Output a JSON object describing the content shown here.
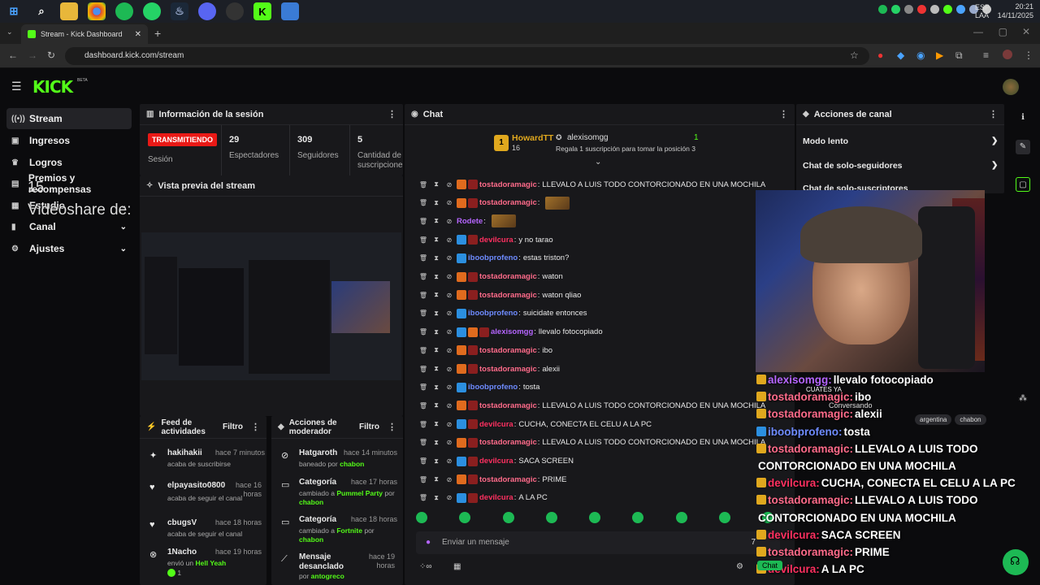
{
  "os": {
    "lang": "ESP\nLAA",
    "time": "20:21",
    "date": "14/11/2025"
  },
  "browser": {
    "tab_title": "Stream - Kick Dashboard",
    "url": "dashboard.kick.com/stream"
  },
  "header": {
    "logo": "KICK",
    "beta": "BETA"
  },
  "sidebar": {
    "items": [
      {
        "label": "Stream",
        "icon": "broadcast-icon"
      },
      {
        "label": "Ingresos",
        "icon": "money-icon"
      },
      {
        "label": "Logros",
        "icon": "trophy-icon"
      },
      {
        "label": "Premios y recompensas",
        "icon": "gift-icon"
      },
      {
        "label": "Estudio",
        "icon": "studio-icon"
      },
      {
        "label": "Canal",
        "icon": "channel-icon"
      },
      {
        "label": "Ajustes",
        "icon": "gear-icon"
      }
    ]
  },
  "overlay": {
    "videoshare": "Videoshare de:",
    "number": "15"
  },
  "session": {
    "title": "Información de la sesión",
    "live_badge": "TRANSMITIENDO",
    "session_label": "Sesión",
    "stats": [
      {
        "value": "29",
        "label": "Espectadores"
      },
      {
        "value": "309",
        "label": "Seguidores"
      },
      {
        "value": "5",
        "label": "Cantidad de suscripciones"
      }
    ]
  },
  "preview": {
    "title": "Vista previa del stream"
  },
  "feed": {
    "title": "Feed de actividades",
    "filter": "Filtro",
    "items": [
      {
        "name": "hakihakii",
        "time": "hace 7 minutos",
        "desc": "acaba de suscribirse",
        "icon": "sparkle-icon"
      },
      {
        "name": "elpayasito0800",
        "time": "hace 16 horas",
        "desc": "acaba de seguir el canal",
        "icon": "heart-icon"
      },
      {
        "name": "cbugsV",
        "time": "hace 18 horas",
        "desc": "acaba de seguir el canal",
        "icon": "heart-icon"
      },
      {
        "name": "1Nacho",
        "time": "hace 19 horas",
        "desc": "envió un",
        "extra": "Hell Yeah",
        "count": "1",
        "icon": "kick-icon"
      }
    ]
  },
  "mod": {
    "title": "Acciones de moderador",
    "filter": "Filtro",
    "items": [
      {
        "name": "Hatgaroth",
        "time": "hace 14 minutos",
        "desc": "baneado por",
        "extra": "chabon",
        "icon": "ban-icon"
      },
      {
        "name": "Categoría",
        "time": "hace 17 horas",
        "desc": "cambiado a",
        "extra": "Pummel Party",
        "by": "por",
        "who": "chabon",
        "icon": "category-icon"
      },
      {
        "name": "Categoría",
        "time": "hace 18 horas",
        "desc": "cambiado a",
        "extra": "Fortnite",
        "by": "por",
        "who": "chabon",
        "icon": "category-icon"
      },
      {
        "name": "Mensaje desanclado",
        "time": "hace 19 horas",
        "desc": "por",
        "extra": "antogreco",
        "icon": "unpin-icon"
      }
    ]
  },
  "chat": {
    "title": "Chat",
    "pinned": {
      "rank": "1",
      "user": "HowardTT",
      "count": "16",
      "other": "alexisomgg",
      "other_count": "1",
      "hint": "Regala 1 suscripción para tomar la posición 3"
    },
    "messages": [
      {
        "user": "tostadoramagic",
        "color": "#ff6b8a",
        "text": "LLEVALO A LUIS TODO CONTORCIONADO EN UNA MOCHILA",
        "badges": [
          "vip",
          "og"
        ]
      },
      {
        "user": "tostadoramagic",
        "color": "#ff6b8a",
        "text": "",
        "emote": true,
        "badges": [
          "vip",
          "og"
        ]
      },
      {
        "user": "Rodete",
        "color": "#b565ff",
        "text": "",
        "emote": true,
        "badges": []
      },
      {
        "user": "devilcura",
        "color": "#ff3060",
        "text": "y no tarao",
        "badges": [
          "sub",
          "og"
        ]
      },
      {
        "user": "iboobprofeno",
        "color": "#6e8bff",
        "text": "estas triston?",
        "badges": [
          "sub"
        ]
      },
      {
        "user": "tostadoramagic",
        "color": "#ff6b8a",
        "text": "waton",
        "badges": [
          "vip",
          "og"
        ]
      },
      {
        "user": "tostadoramagic",
        "color": "#ff6b8a",
        "text": "waton qliao",
        "badges": [
          "vip",
          "og"
        ]
      },
      {
        "user": "iboobprofeno",
        "color": "#6e8bff",
        "text": "suicidate entonces",
        "badges": [
          "sub"
        ]
      },
      {
        "user": "alexisomgg",
        "color": "#b565ff",
        "text": "llevalo fotocopiado",
        "badges": [
          "sub",
          "vip",
          "og"
        ]
      },
      {
        "user": "tostadoramagic",
        "color": "#ff6b8a",
        "text": "ibo",
        "badges": [
          "vip",
          "og"
        ]
      },
      {
        "user": "tostadoramagic",
        "color": "#ff6b8a",
        "text": "alexii",
        "badges": [
          "vip",
          "og"
        ]
      },
      {
        "user": "iboobprofeno",
        "color": "#6e8bff",
        "text": "tosta",
        "badges": [
          "sub"
        ]
      },
      {
        "user": "tostadoramagic",
        "color": "#ff6b8a",
        "text": "LLEVALO A LUIS TODO CONTORCIONADO EN UNA MOCHILA",
        "badges": [
          "vip",
          "og"
        ]
      },
      {
        "user": "devilcura",
        "color": "#ff3060",
        "text": "CUCHA, CONECTA EL CELU A LA PC",
        "badges": [
          "sub",
          "og"
        ]
      },
      {
        "user": "tostadoramagic",
        "color": "#ff6b8a",
        "text": "LLEVALO A LUIS TODO CONTORCIONADO EN UNA MOCHILA",
        "badges": [
          "vip",
          "og"
        ]
      },
      {
        "user": "devilcura",
        "color": "#ff3060",
        "text": "SACA SCREEN",
        "badges": [
          "sub",
          "og"
        ]
      },
      {
        "user": "tostadoramagic",
        "color": "#ff6b8a",
        "text": "PRIME",
        "badges": [
          "vip",
          "og"
        ]
      },
      {
        "user": "devilcura",
        "color": "#ff3060",
        "text": "A LA PC",
        "badges": [
          "sub",
          "og"
        ]
      }
    ],
    "input_placeholder": "Enviar un mensaje"
  },
  "actions": {
    "title": "Acciones de canal",
    "items": [
      "Modo lento",
      "Chat de solo-seguidores",
      "Chat de solo-suscriptores"
    ]
  },
  "overlay_chat": {
    "lines": [
      {
        "user": "alexisomgg:",
        "text": "llevalo fotocopiado",
        "color": "#b565ff"
      },
      {
        "user": "tostadoramagic:",
        "text": "ibo",
        "color": "#ff6b8a"
      },
      {
        "user": "tostadoramagic:",
        "text": "alexii",
        "color": "#ff6b8a"
      },
      {
        "user": "iboobprofeno:",
        "text": "tosta",
        "color": "#6e8bff"
      },
      {
        "user": "tostadoramagic:",
        "text": "LLEVALO A LUIS TODO",
        "color": "#ff6b8a"
      },
      {
        "user": "",
        "text": "CONTORCIONADO EN UNA MOCHILA",
        "color": "#ff6b8a"
      },
      {
        "user": "devilcura:",
        "text": "CUCHA, CONECTA EL CELU A LA PC",
        "color": "#ff3060"
      },
      {
        "user": "tostadoramagic:",
        "text": "LLEVALO A LUIS TODO",
        "color": "#ff6b8a"
      },
      {
        "user": "",
        "text": "CONTORCIONADO EN UNA MOCHILA",
        "color": "#ff6b8a"
      },
      {
        "user": "devilcura:",
        "text": "SACA SCREEN",
        "color": "#ff3060"
      },
      {
        "user": "tostadoramagic:",
        "text": "PRIME",
        "color": "#ff6b8a"
      },
      {
        "user": "devilcura:",
        "text": "A LA PC",
        "color": "#ff3060"
      }
    ],
    "popup": {
      "title": "CUATES YA",
      "sub": "Conversando"
    },
    "tags": [
      "argentina",
      "chabon"
    ],
    "chat_label": "Chat"
  },
  "colors": {
    "accent": "#53fc18",
    "live": "#e91916",
    "panel": "#18181b"
  }
}
